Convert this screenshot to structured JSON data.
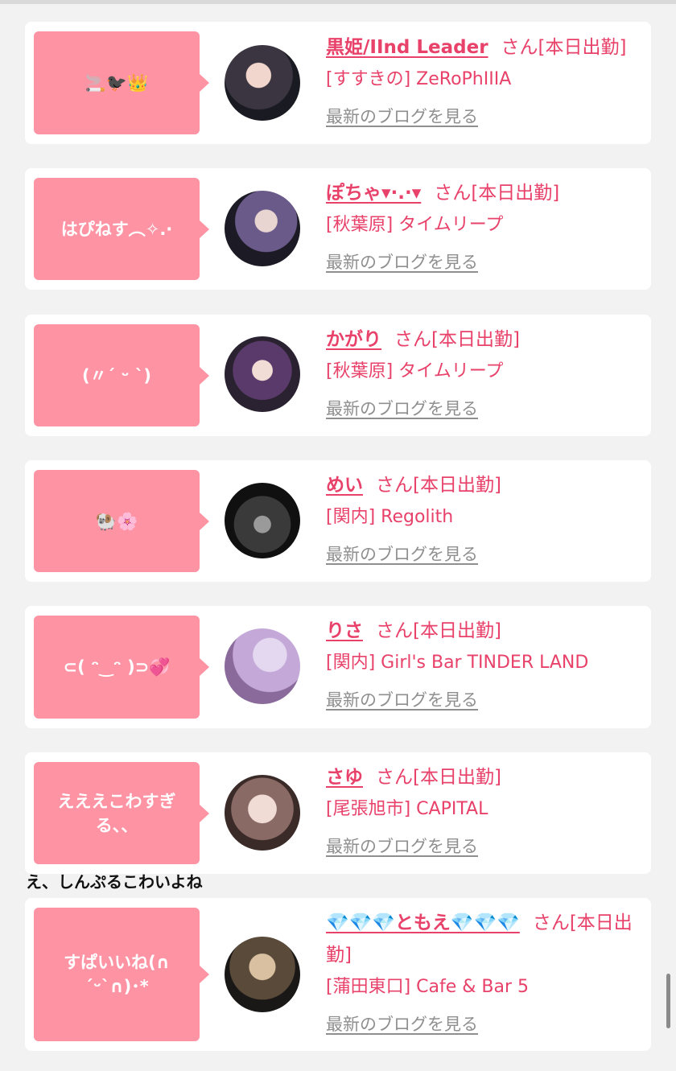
{
  "suffix": "さん[本日出勤]",
  "blog_link": "最新のブログを見る",
  "entries": [
    {
      "bubble": "🚬🐦‍⬛👑",
      "name": "黒姫/IInd Leader",
      "store": "[すすきの] ZeRoPhIIIA"
    },
    {
      "bubble": "はぴねす︵✧.·",
      "name": "ぽちゃ▾·.·▾",
      "store": "[秋葉原] タイムリープ"
    },
    {
      "bubble": "(〃ˊ ᵕ ˋ)",
      "name": "かがり",
      "store": "[秋葉原] タイムリープ"
    },
    {
      "bubble": "🐏🌸",
      "name": "めい",
      "store": "[関内] Regolith"
    },
    {
      "bubble": "⊂( ᵔ‿ᵔ )⊃💞",
      "name": "りさ",
      "store": "[関内] Girl's Bar TINDER LAND"
    },
    {
      "bubble": "えええこわすぎる、、",
      "name": "さゆ",
      "store": "[尾張旭市] CAPITAL"
    },
    {
      "bubble": "すぱいいね(∩´ᵕ`∩)･*",
      "name": "💎💎💎ともえ💎💎💎",
      "store": "[蒲田東口] Cafe & Bar 5"
    }
  ],
  "comment": "え、しんぷるこわいよね",
  "colors": {
    "accent": "#e8416a",
    "bubble": "#fe93a4",
    "link": "#8f8f8f",
    "background": "#f2f2f2"
  }
}
